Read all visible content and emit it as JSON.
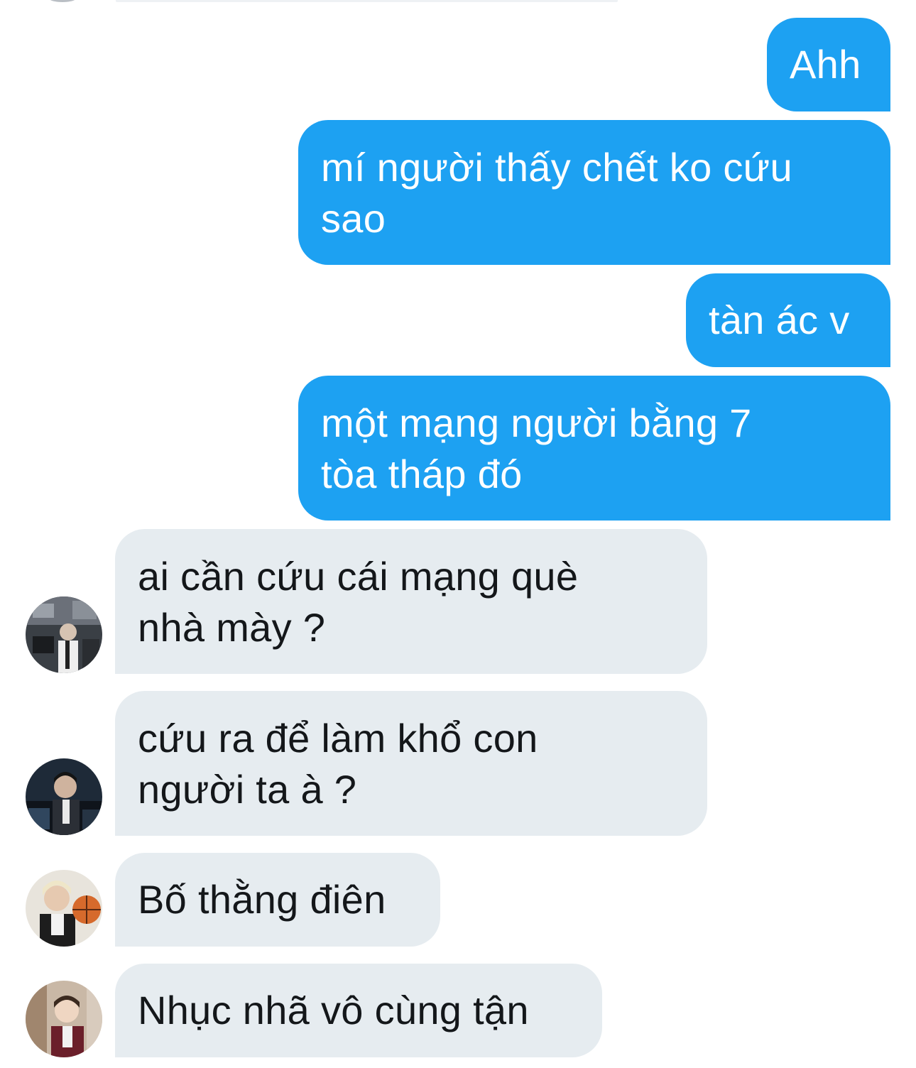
{
  "conversation": {
    "messages": [
      {
        "direction": "outgoing",
        "lines": [
          "Ahh"
        ]
      },
      {
        "direction": "outgoing",
        "lines": [
          "mí người thấy chết ko cứu",
          "sao"
        ]
      },
      {
        "direction": "outgoing",
        "lines": [
          "tàn ác v"
        ]
      },
      {
        "direction": "outgoing",
        "lines": [
          "một mạng người bằng 7",
          "tòa tháp đó"
        ]
      },
      {
        "direction": "incoming",
        "avatar": "avatar-photo-1",
        "lines": [
          "ai cần cứu cái mạng què",
          "nhà mày ?"
        ]
      },
      {
        "direction": "incoming",
        "avatar": "avatar-photo-2",
        "lines": [
          "cứu ra để làm khổ con",
          "người ta à ?"
        ]
      },
      {
        "direction": "incoming",
        "avatar": "avatar-photo-3",
        "lines": [
          "Bố thằng điên"
        ]
      },
      {
        "direction": "incoming",
        "avatar": "avatar-photo-4",
        "lines": [
          "Nhục nhã vô cùng tận"
        ]
      }
    ]
  },
  "colors": {
    "outgoing_bubble": "#1da1f2",
    "incoming_bubble": "#e6ecf0",
    "outgoing_text": "#ffffff",
    "incoming_text": "#14171a",
    "background": "#ffffff"
  }
}
